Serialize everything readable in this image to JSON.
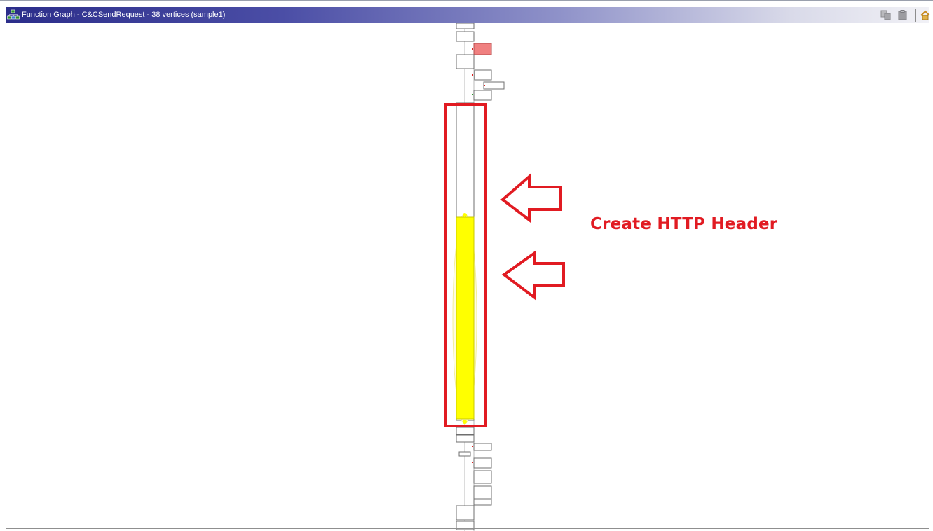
{
  "window": {
    "title": "Function Graph - C&CSendRequest - 38 vertices  (sample1)",
    "icon": "function-graph-icon"
  },
  "toolbar": {
    "buttons": [
      "copy-icon",
      "paste-icon",
      "home-icon"
    ]
  },
  "annotation": {
    "label": "Create HTTP Header",
    "color": "#e11b22"
  },
  "graph": {
    "highlight_color": "#ffff00",
    "entry_block_color": "#f08080"
  }
}
